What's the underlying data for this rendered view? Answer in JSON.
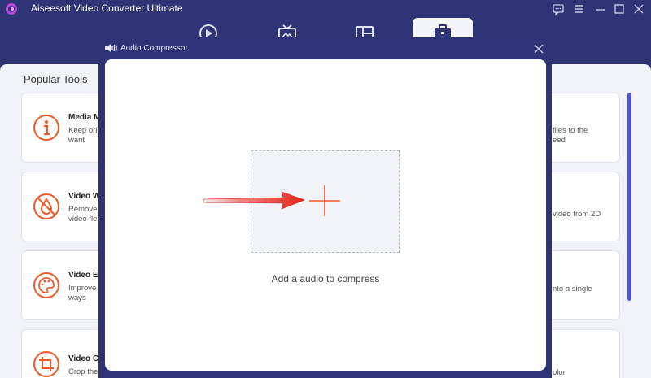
{
  "app": {
    "title": "Aiseesoft Video Converter Ultimate"
  },
  "nav": {
    "tabs": [
      "converter-icon",
      "mv-icon",
      "collage-icon",
      "toolbox-icon"
    ],
    "active_tab": "toolbox-icon"
  },
  "popular_tools": {
    "title": "Popular Tools",
    "left_column": [
      {
        "name": "Media M",
        "desc": "Keep origi\nwant",
        "icon": "info-icon"
      },
      {
        "name": "Video W",
        "desc": "Remove\nvideo fle:",
        "icon": "watermark-remover-icon"
      },
      {
        "name": "Video E",
        "desc": "Improve\nways",
        "icon": "palette-icon"
      },
      {
        "name": "Video C",
        "desc": "Crop the",
        "icon": "crop-icon"
      }
    ],
    "right_column": [
      {
        "desc": "files to the\need"
      },
      {
        "desc": "video from 2D"
      },
      {
        "desc": "nto a single"
      },
      {
        "desc": "olor"
      }
    ],
    "middle_fragment": "video"
  },
  "dialog": {
    "title": "Audio Compressor",
    "drop_label": "Add a audio to compress"
  },
  "colors": {
    "bg_dark": "#2f3476",
    "accent_orange": "#f05a28",
    "arrow_red": "#e8201a",
    "scrollbar": "#4f55d8"
  }
}
